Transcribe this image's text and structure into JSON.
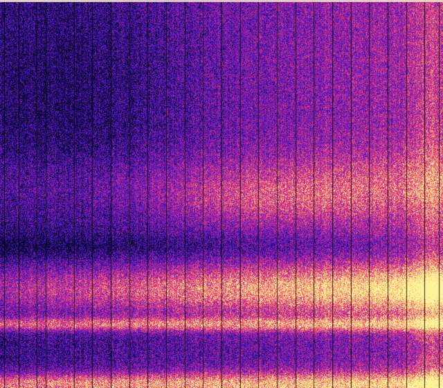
{
  "image": {
    "kind": "spectrogram-style heatmap",
    "colormap": [
      "#0a0520",
      "#2a0e8e",
      "#4a1bc0",
      "#8a1fb3",
      "#c8288f",
      "#ef4c78",
      "#f8a06a",
      "#fff39a"
    ],
    "background_color": "#000000",
    "overlay_line_color": "#000000",
    "top_edge_color": "#f3e9c8"
  }
}
